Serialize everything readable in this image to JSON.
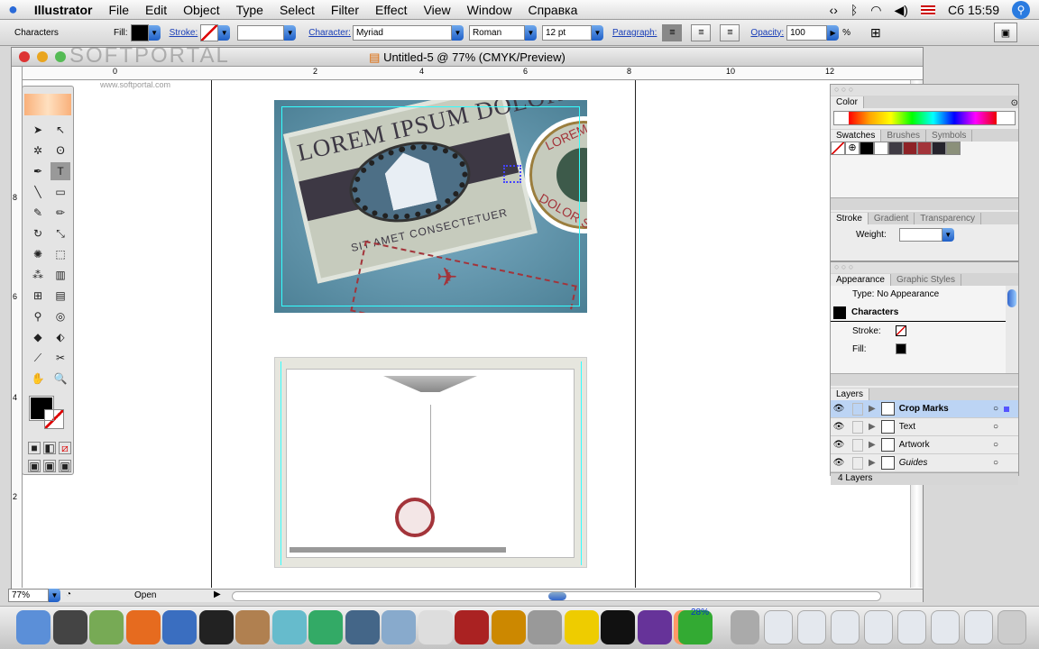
{
  "menubar": {
    "app": "Illustrator",
    "items": [
      "File",
      "Edit",
      "Object",
      "Type",
      "Select",
      "Filter",
      "Effect",
      "View",
      "Window",
      "Справка"
    ],
    "clock": "Сб 15:59"
  },
  "control": {
    "label": "Characters",
    "fill": "Fill:",
    "stroke": "Stroke:",
    "character": "Character:",
    "font": "Myriad",
    "style": "Roman",
    "size": "12 pt",
    "paragraph": "Paragraph:",
    "opacity_label": "Opacity:",
    "opacity": "100",
    "percent": "%"
  },
  "document": {
    "title": "Untitled-5 @ 77% (CMYK/Preview)",
    "watermark": "SOFTPORTAL",
    "watermark_url": "www.softportal.com",
    "hruler": [
      "0",
      "2",
      "4",
      "6",
      "8",
      "10",
      "12"
    ],
    "vruler": [
      "8",
      "6",
      "4",
      "2"
    ],
    "zoom": "77%",
    "status": "Open"
  },
  "artwork": {
    "headline": "LOREM IPSUM DOLOR",
    "sub": "SIT AMET CONSECTETUER",
    "seal_top": "LOREM",
    "seal_bottom": "DOLOR S"
  },
  "panels": {
    "color": {
      "tab": "Color"
    },
    "swatches": {
      "tabs": [
        "Swatches",
        "Brushes",
        "Symbols"
      ],
      "colors": [
        "#000000",
        "#ffffff",
        "#3f3b44",
        "#8e2226",
        "#a3343a",
        "#25232c",
        "#8b907a"
      ]
    },
    "stroke": {
      "tabs": [
        "Stroke",
        "Gradient",
        "Transparency"
      ],
      "weight": "Weight:"
    },
    "appearance": {
      "tabs": [
        "Appearance",
        "Graphic Styles"
      ],
      "type": "Type: No Appearance",
      "target": "Characters",
      "stroke": "Stroke:",
      "fill": "Fill:"
    },
    "layers": {
      "tab": "Layers",
      "items": [
        {
          "name": "Crop Marks",
          "selected": true
        },
        {
          "name": "Text"
        },
        {
          "name": "Artwork"
        },
        {
          "name": "Guides"
        }
      ],
      "count": "4 Layers"
    }
  },
  "dock": {
    "items": [
      "Finder",
      "Dashboard",
      "Pencil",
      "Firefox",
      "Thunderbird",
      "X11",
      "Address Book",
      "iTunes",
      "iPhoto",
      "iMovie",
      "iDVD",
      "iCal",
      "Theater",
      "Preview",
      "Apple",
      "Utility",
      "Terminal",
      "Media",
      "Illustrator",
      "Update"
    ],
    "update_badge": "28%"
  }
}
